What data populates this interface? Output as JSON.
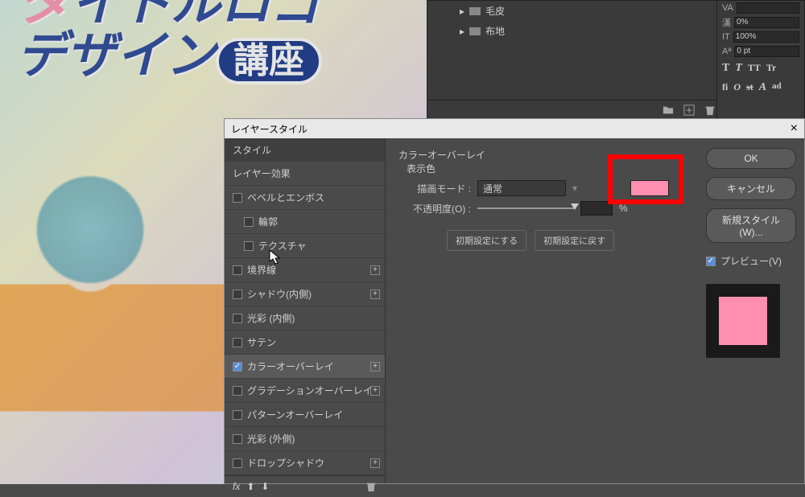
{
  "canvas": {
    "title_line1_pink": "タ",
    "title_line1_blue": "イトルロゴ",
    "title_line2_blue": "デザイン",
    "badge": "講座"
  },
  "layers_panel": {
    "items": [
      "毛皮",
      "布地"
    ]
  },
  "char_panel": {
    "va_label": "VA",
    "kerning_label": "漢",
    "kerning_value": "0%",
    "it_height_label": "IT",
    "it_height_value": "100%",
    "baseline_label": "Aª",
    "baseline_value": "0 pt"
  },
  "type_toolbar": {
    "bold": "T",
    "italic": "T",
    "allcaps": "TT",
    "smallcaps": "Tr",
    "fi": "fi",
    "alt": "O",
    "st": "st",
    "italic_a": "A",
    "ad": "ad"
  },
  "dialog": {
    "title": "レイヤースタイル",
    "styles_header": "スタイル",
    "styles": [
      {
        "label": "レイヤー効果",
        "checkbox": false,
        "indent": false,
        "plus": false
      },
      {
        "label": "ベベルとエンボス",
        "checkbox": true,
        "indent": false,
        "plus": false
      },
      {
        "label": "輪郭",
        "checkbox": true,
        "indent": true,
        "plus": false
      },
      {
        "label": "テクスチャ",
        "checkbox": true,
        "indent": true,
        "plus": false
      },
      {
        "label": "境界線",
        "checkbox": true,
        "indent": false,
        "plus": true
      },
      {
        "label": "シャドウ(内側)",
        "checkbox": true,
        "indent": false,
        "plus": true
      },
      {
        "label": "光彩 (内側)",
        "checkbox": true,
        "indent": false,
        "plus": false
      },
      {
        "label": "サテン",
        "checkbox": true,
        "indent": false,
        "plus": false
      },
      {
        "label": "カラーオーバーレイ",
        "checkbox": true,
        "checked": true,
        "selected": true,
        "indent": false,
        "plus": true
      },
      {
        "label": "グラデーションオーバーレイ",
        "checkbox": true,
        "indent": false,
        "plus": true
      },
      {
        "label": "パターンオーバーレイ",
        "checkbox": true,
        "indent": false,
        "plus": false
      },
      {
        "label": "光彩 (外側)",
        "checkbox": true,
        "indent": false,
        "plus": false
      },
      {
        "label": "ドロップシャドウ",
        "checkbox": true,
        "indent": false,
        "plus": true
      }
    ],
    "fx_label": "fx",
    "detail": {
      "section": "カラーオーバーレイ",
      "subsection": "表示色",
      "blend_mode_label": "描画モード :",
      "blend_mode_value": "通常",
      "opacity_label": "不透明度(O) :",
      "opacity_unit": "%",
      "reset_default": "初期設定にする",
      "reset_revert": "初期設定に戻す"
    },
    "buttons": {
      "ok": "OK",
      "cancel": "キャンセル",
      "new_style": "新規スタイル(W)...",
      "preview": "プレビュー(V)"
    }
  }
}
